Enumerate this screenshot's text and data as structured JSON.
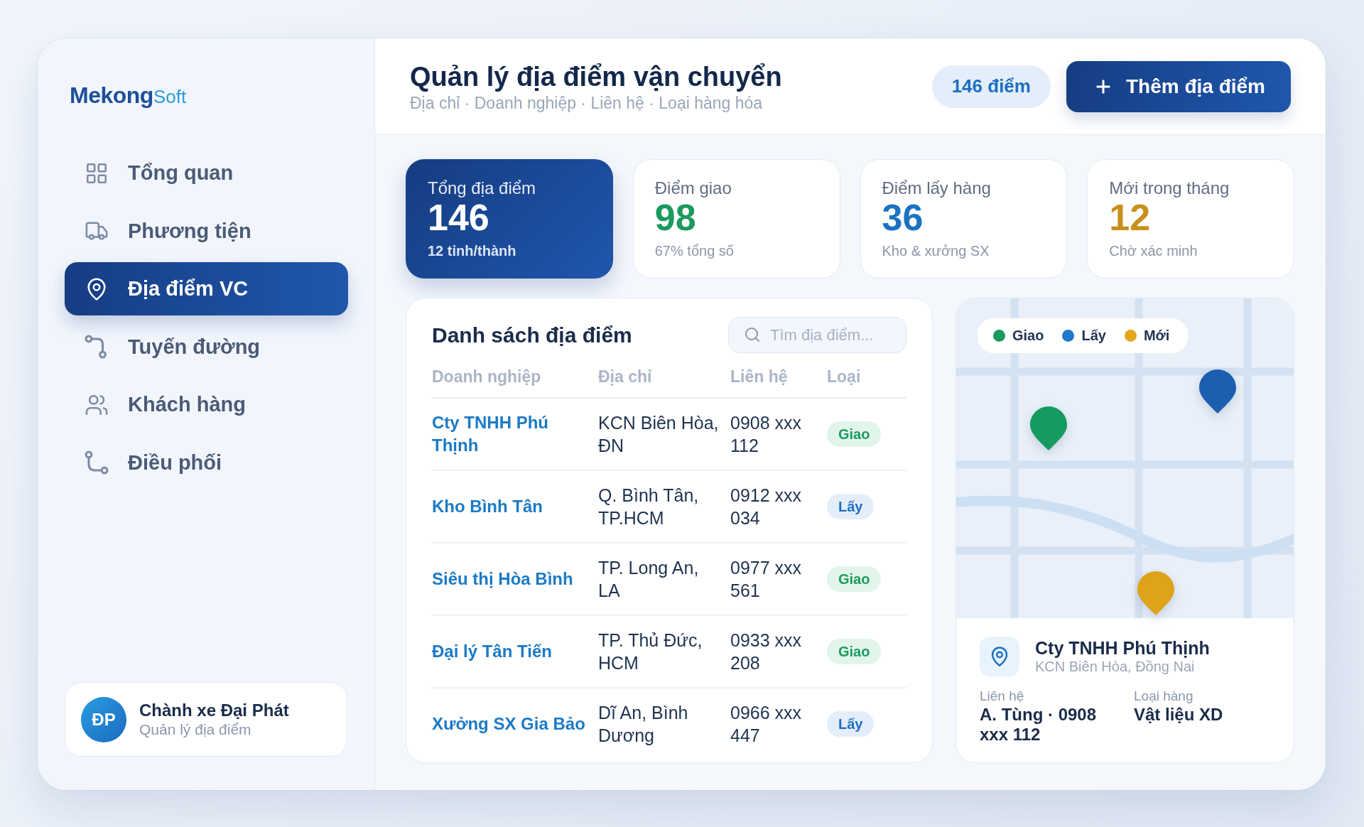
{
  "sidebar": {
    "logo": {
      "primary": "Mekong",
      "secondary": "Soft"
    },
    "nav_items": [
      {
        "label": "Tổng quan",
        "selected": false
      },
      {
        "label": "Phương tiện",
        "selected": false
      },
      {
        "label": "Địa điểm VC",
        "selected": true
      },
      {
        "label": "Tuyến đường",
        "selected": false
      },
      {
        "label": "Khách hàng",
        "selected": false
      },
      {
        "label": "Điều phối",
        "selected": false
      }
    ],
    "user": {
      "initials": "ĐP",
      "name": "Chành xe Đại Phát",
      "role": "Quản lý địa điểm"
    }
  },
  "header": {
    "title": "Quản lý địa điểm vận chuyển",
    "subtitle": "Địa chỉ · Doanh nghiệp · Liên hệ · Loại hàng hóa",
    "count_badge": "146 điểm",
    "add_button": "Thêm địa điểm"
  },
  "stats": [
    {
      "label": "Tổng địa điểm",
      "value": "146",
      "note": "12 tỉnh/thành",
      "selected": true
    },
    {
      "label": "Điểm giao",
      "value": "98",
      "note": "67% tổng số",
      "selected": false,
      "color": "#1a9a5e"
    },
    {
      "label": "Điểm lấy hàng",
      "value": "36",
      "note": "Kho & xưởng SX",
      "selected": false,
      "color": "#1c72c2"
    },
    {
      "label": "Mới trong tháng",
      "value": "12",
      "note": "Chờ xác minh",
      "selected": false,
      "color": "#c8901a"
    }
  ],
  "table": {
    "title": "Danh sách địa điểm",
    "search": {
      "placeholder": "Tìm địa điểm..."
    },
    "columns": [
      "Doanh nghiệp",
      "Địa chỉ",
      "Liên hệ",
      "Loại"
    ],
    "rows": [
      {
        "company": "Cty TNHH Phú Thịnh",
        "address": "KCN Biên Hòa, ĐN",
        "contact": "0908 xxx 112",
        "type": {
          "label": "Giao",
          "kind": "delivery"
        }
      },
      {
        "company": "Kho Bình Tân",
        "address": "Q. Bình Tân, TP.HCM",
        "contact": "0912 xxx 034",
        "type": {
          "label": "Lấy",
          "kind": "pickup"
        }
      },
      {
        "company": "Siêu thị Hòa Bình",
        "address": "TP. Long An, LA",
        "contact": "0977 xxx 561",
        "type": {
          "label": "Giao",
          "kind": "delivery"
        }
      },
      {
        "company": "Đại lý Tân Tiến",
        "address": "TP. Thủ Đức, HCM",
        "contact": "0933 xxx 208",
        "type": {
          "label": "Giao",
          "kind": "delivery"
        }
      },
      {
        "company": "Xưởng SX Gia Bảo",
        "address": "Dĩ An, Bình Dương",
        "contact": "0966 xxx 447",
        "type": {
          "label": "Lấy",
          "kind": "pickup"
        }
      }
    ]
  },
  "map": {
    "legend": [
      {
        "label": "Giao",
        "color": "#1a9a5e"
      },
      {
        "label": "Lấy",
        "color": "#1f78c8"
      },
      {
        "label": "Mới",
        "color": "#e2a61c"
      }
    ],
    "pins": [
      {
        "color": "#169a5f"
      },
      {
        "color": "#1c5fb0"
      },
      {
        "color": "#dea31a"
      }
    ],
    "detail": {
      "name": "Cty TNHH Phú Thịnh",
      "address": "KCN Biên Hòa, Đồng Nai",
      "fields": [
        {
          "label": "Liên hệ",
          "value": "A. Tùng · 0908 xxx 112"
        },
        {
          "label": "Loại hàng",
          "value": "Vật liệu XD"
        }
      ]
    }
  }
}
